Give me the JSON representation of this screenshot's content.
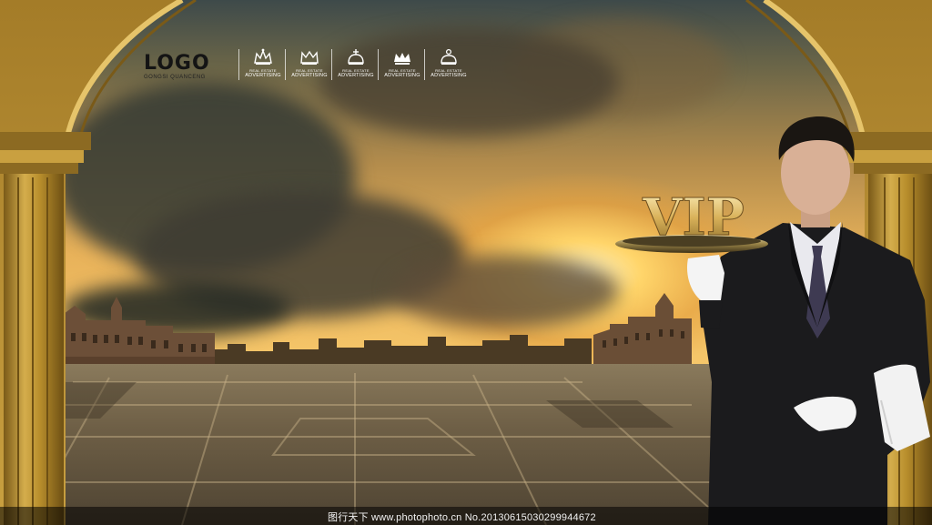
{
  "logo": {
    "title": "LOGO",
    "subtitle": "GONGSI QUANCENG"
  },
  "categories": [
    {
      "icon": "crown-icon",
      "line1": "REAL ESTATE",
      "line2": "ADVERTISING"
    },
    {
      "icon": "crown-icon",
      "line1": "REAL ESTATE",
      "line2": "ADVERTISING"
    },
    {
      "icon": "crown-icon",
      "line1": "REAL ESTATE",
      "line2": "ADVERTISING"
    },
    {
      "icon": "crown-icon",
      "line1": "REAL ESTATE",
      "line2": "ADVERTISING"
    },
    {
      "icon": "crown-icon",
      "line1": "REAL ESTATE",
      "line2": "ADVERTISING"
    }
  ],
  "tray": {
    "text": "VIP"
  },
  "watermark": {
    "text": "图行天下 www.photophoto.cn No.20130615030299944672"
  },
  "colors": {
    "arch_gold": "#b8922e",
    "sky_glow": "#ffd56a",
    "suit": "#1b1b1d",
    "vip_gold": "#d9b25a"
  }
}
